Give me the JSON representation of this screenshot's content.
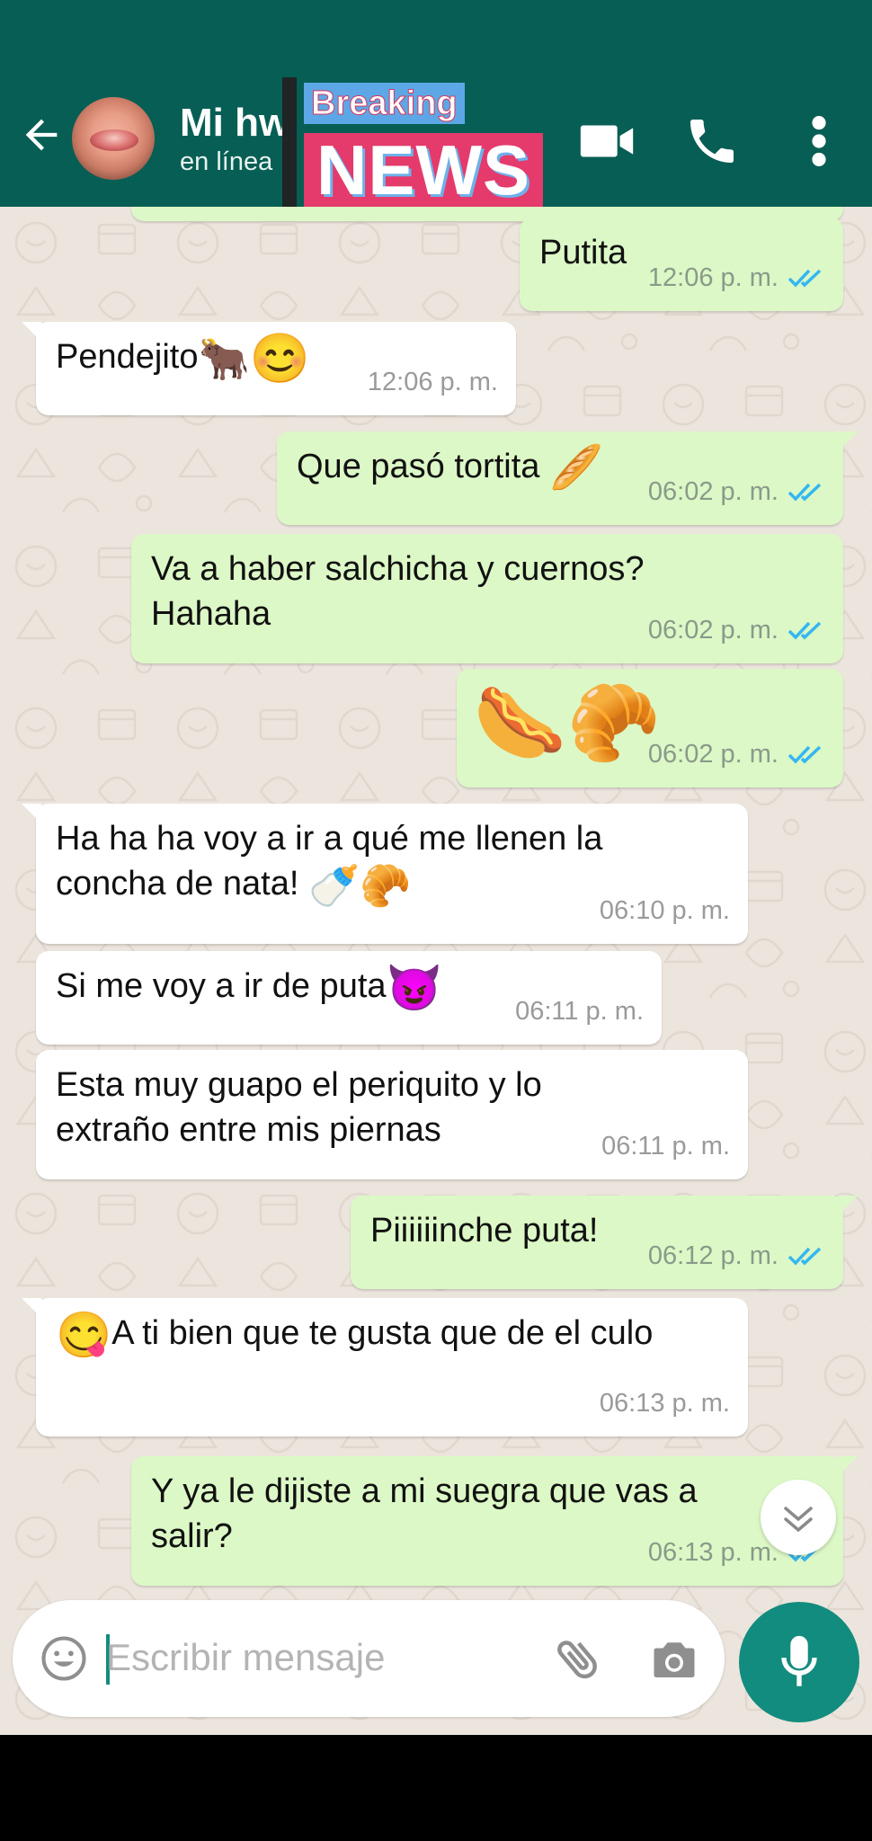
{
  "header": {
    "contact_name": "Mi hw",
    "contact_status": "en línea",
    "overlay": {
      "breaking": "Breaking",
      "news": "NEWS"
    }
  },
  "icons": [
    "back-arrow-icon",
    "video-call-icon",
    "phone-icon",
    "more-vert-icon",
    "emoji-icon",
    "attach-icon",
    "camera-icon",
    "mic-icon",
    "chevron-double-down-icon"
  ],
  "messages": [
    {
      "dir": "out",
      "text": "Putita",
      "time": "12:06 p. m.",
      "ticks": "read"
    },
    {
      "dir": "in",
      "text": "Pendejito",
      "emojis": [
        "🐂",
        "😊"
      ],
      "time": "12:06 p. m."
    },
    {
      "dir": "out",
      "text": "Que pasó tortita ",
      "emojis": [
        "🥖"
      ],
      "time": "06:02 p. m.",
      "ticks": "read"
    },
    {
      "dir": "out",
      "lines": [
        "Va a haber salchicha y cuernos?",
        "Hahaha"
      ],
      "time": "06:02 p. m.",
      "ticks": "read"
    },
    {
      "dir": "out",
      "emojis": [
        "🌭",
        "🥐"
      ],
      "time": "06:02 p. m.",
      "ticks": "read"
    },
    {
      "dir": "in",
      "lines": [
        "Ha ha ha voy a ir a qué me llenen la",
        "concha de nata! "
      ],
      "emojis": [
        "🍼",
        "🥐"
      ],
      "time": "06:10 p. m."
    },
    {
      "dir": "in",
      "text": "Si me voy a ir de puta",
      "emojis": [
        "😈"
      ],
      "time": "06:11 p. m."
    },
    {
      "dir": "in",
      "lines": [
        "Esta muy guapo el periquito y lo",
        "extraño entre mis piernas"
      ],
      "time": "06:11 p. m."
    },
    {
      "dir": "out",
      "text": "Piiiiiinche puta!",
      "time": "06:12 p. m.",
      "ticks": "read"
    },
    {
      "dir": "in",
      "emojis": [
        "😋"
      ],
      "text": "A ti bien que te gusta que de el culo",
      "time": "06:13 p. m."
    },
    {
      "dir": "out",
      "lines": [
        "Y ya le dijiste a mi suegra que vas a",
        "salir?"
      ],
      "time": "06:13 p. m.",
      "ticks": "read"
    }
  ],
  "composer": {
    "placeholder": "Escribir mensaje"
  },
  "colors": {
    "header": "#075e54",
    "accent": "#128c7e",
    "outgoing": "#dcf8c6",
    "incoming": "#ffffff",
    "read_ticks": "#34b7f1",
    "chat_bg": "#ece5dd"
  }
}
